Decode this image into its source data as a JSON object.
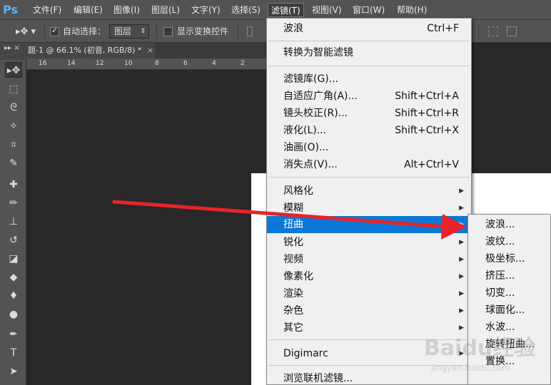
{
  "app": {
    "logo": "Ps"
  },
  "menubar": {
    "items": [
      "文件(F)",
      "编辑(E)",
      "图像(I)",
      "图层(L)",
      "文字(Y)",
      "选择(S)",
      "滤镜(T)",
      "视图(V)",
      "窗口(W)",
      "帮助(H)"
    ],
    "active_index": 6
  },
  "options": {
    "auto_select_label": "自动选择：",
    "auto_select_checked": true,
    "auto_select_target": "图层",
    "show_transform_label": "显示变换控件",
    "show_transform_checked": false
  },
  "document": {
    "tab_title": "题-1 @ 66.1% (初音, RGB/8) *",
    "ruler_ticks": [
      "16",
      "14",
      "12",
      "10",
      "8",
      "6",
      "4",
      "2"
    ]
  },
  "filter_menu": {
    "last_filter": {
      "label": "波浪",
      "shortcut": "Ctrl+F"
    },
    "smart": "转换为智能滤镜",
    "group2": [
      {
        "label": "滤镜库(G)...",
        "shortcut": ""
      },
      {
        "label": "自适应广角(A)...",
        "shortcut": "Shift+Ctrl+A"
      },
      {
        "label": "镜头校正(R)...",
        "shortcut": "Shift+Ctrl+R"
      },
      {
        "label": "液化(L)...",
        "shortcut": "Shift+Ctrl+X"
      },
      {
        "label": "油画(O)...",
        "shortcut": ""
      },
      {
        "label": "消失点(V)...",
        "shortcut": "Alt+Ctrl+V"
      }
    ],
    "categories": [
      "风格化",
      "模糊",
      "扭曲",
      "锐化",
      "视频",
      "像素化",
      "渲染",
      "杂色",
      "其它"
    ],
    "highlighted_category": "扭曲",
    "digimarc": "Digimarc",
    "browse_online": "浏览联机滤镜..."
  },
  "distort_submenu": {
    "items": [
      "波浪...",
      "波纹...",
      "极坐标...",
      "挤压...",
      "切变...",
      "球面化...",
      "水波...",
      "旋转扭曲...",
      "置换..."
    ]
  },
  "colors": {
    "highlight": "#0a78d7",
    "arrow": "#e8232a",
    "ui_panel": "#535353"
  },
  "watermark": {
    "text": "Baidu经验",
    "sub": "jingyan.baidu.com"
  }
}
